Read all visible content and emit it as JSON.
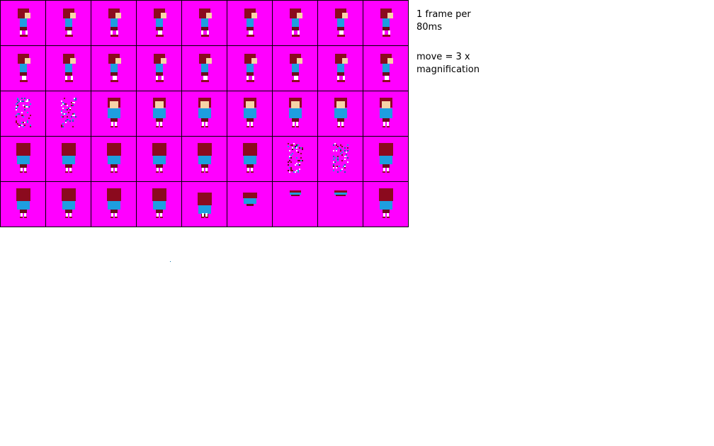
{
  "sheet": {
    "background_color": "#ff00ff",
    "grid_color": "#000000",
    "columns": 9,
    "rows": 5,
    "palette": {
      "hair": "#8b0a1e",
      "hair_shade": "#5a0612",
      "skin": "#f7d3a7",
      "shirt": "#1e9ee0",
      "shirt_shade": "#0b6fa8",
      "shorts": "#6b0d1c",
      "socks": "#ffffff",
      "shoes": "#8b0a1e"
    },
    "frames": [
      [
        "side",
        "side",
        "side",
        "side",
        "side",
        "side",
        "side",
        "side",
        "side"
      ],
      [
        "side",
        "side",
        "side",
        "side",
        "side",
        "side",
        "side",
        "side",
        "side"
      ],
      [
        "sparkle",
        "sparkle",
        "front",
        "front",
        "front",
        "front",
        "front",
        "front",
        "front"
      ],
      [
        "back",
        "back",
        "back",
        "back",
        "back",
        "back",
        "sparkle-back",
        "sparkle",
        "back"
      ],
      [
        "back",
        "back",
        "back",
        "back",
        "back-crouch",
        "squash",
        "flat",
        "flat-small",
        "back"
      ]
    ]
  },
  "notes": {
    "frame_rate": "1 frame per\n80ms",
    "move": "move = 3 x\nmagnification"
  }
}
